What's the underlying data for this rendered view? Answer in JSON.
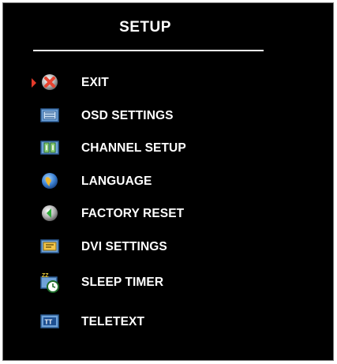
{
  "menu": {
    "title": "SETUP",
    "items": [
      {
        "label": "EXIT",
        "icon": "exit-icon",
        "selected": true
      },
      {
        "label": "OSD SETTINGS",
        "icon": "osd-settings-icon",
        "selected": false
      },
      {
        "label": "CHANNEL SETUP",
        "icon": "channel-setup-icon",
        "selected": false
      },
      {
        "label": "LANGUAGE",
        "icon": "language-globe-icon",
        "selected": false
      },
      {
        "label": "FACTORY RESET",
        "icon": "factory-reset-icon",
        "selected": false
      },
      {
        "label": "DVI SETTINGS",
        "icon": "dvi-settings-icon",
        "selected": false
      },
      {
        "label": "SLEEP TIMER",
        "icon": "sleep-timer-icon",
        "selected": false
      },
      {
        "label": "TELETEXT",
        "icon": "teletext-icon",
        "selected": false
      }
    ]
  },
  "colors": {
    "background": "#000000",
    "text": "#ffffff",
    "selector": "#e53a2a"
  }
}
